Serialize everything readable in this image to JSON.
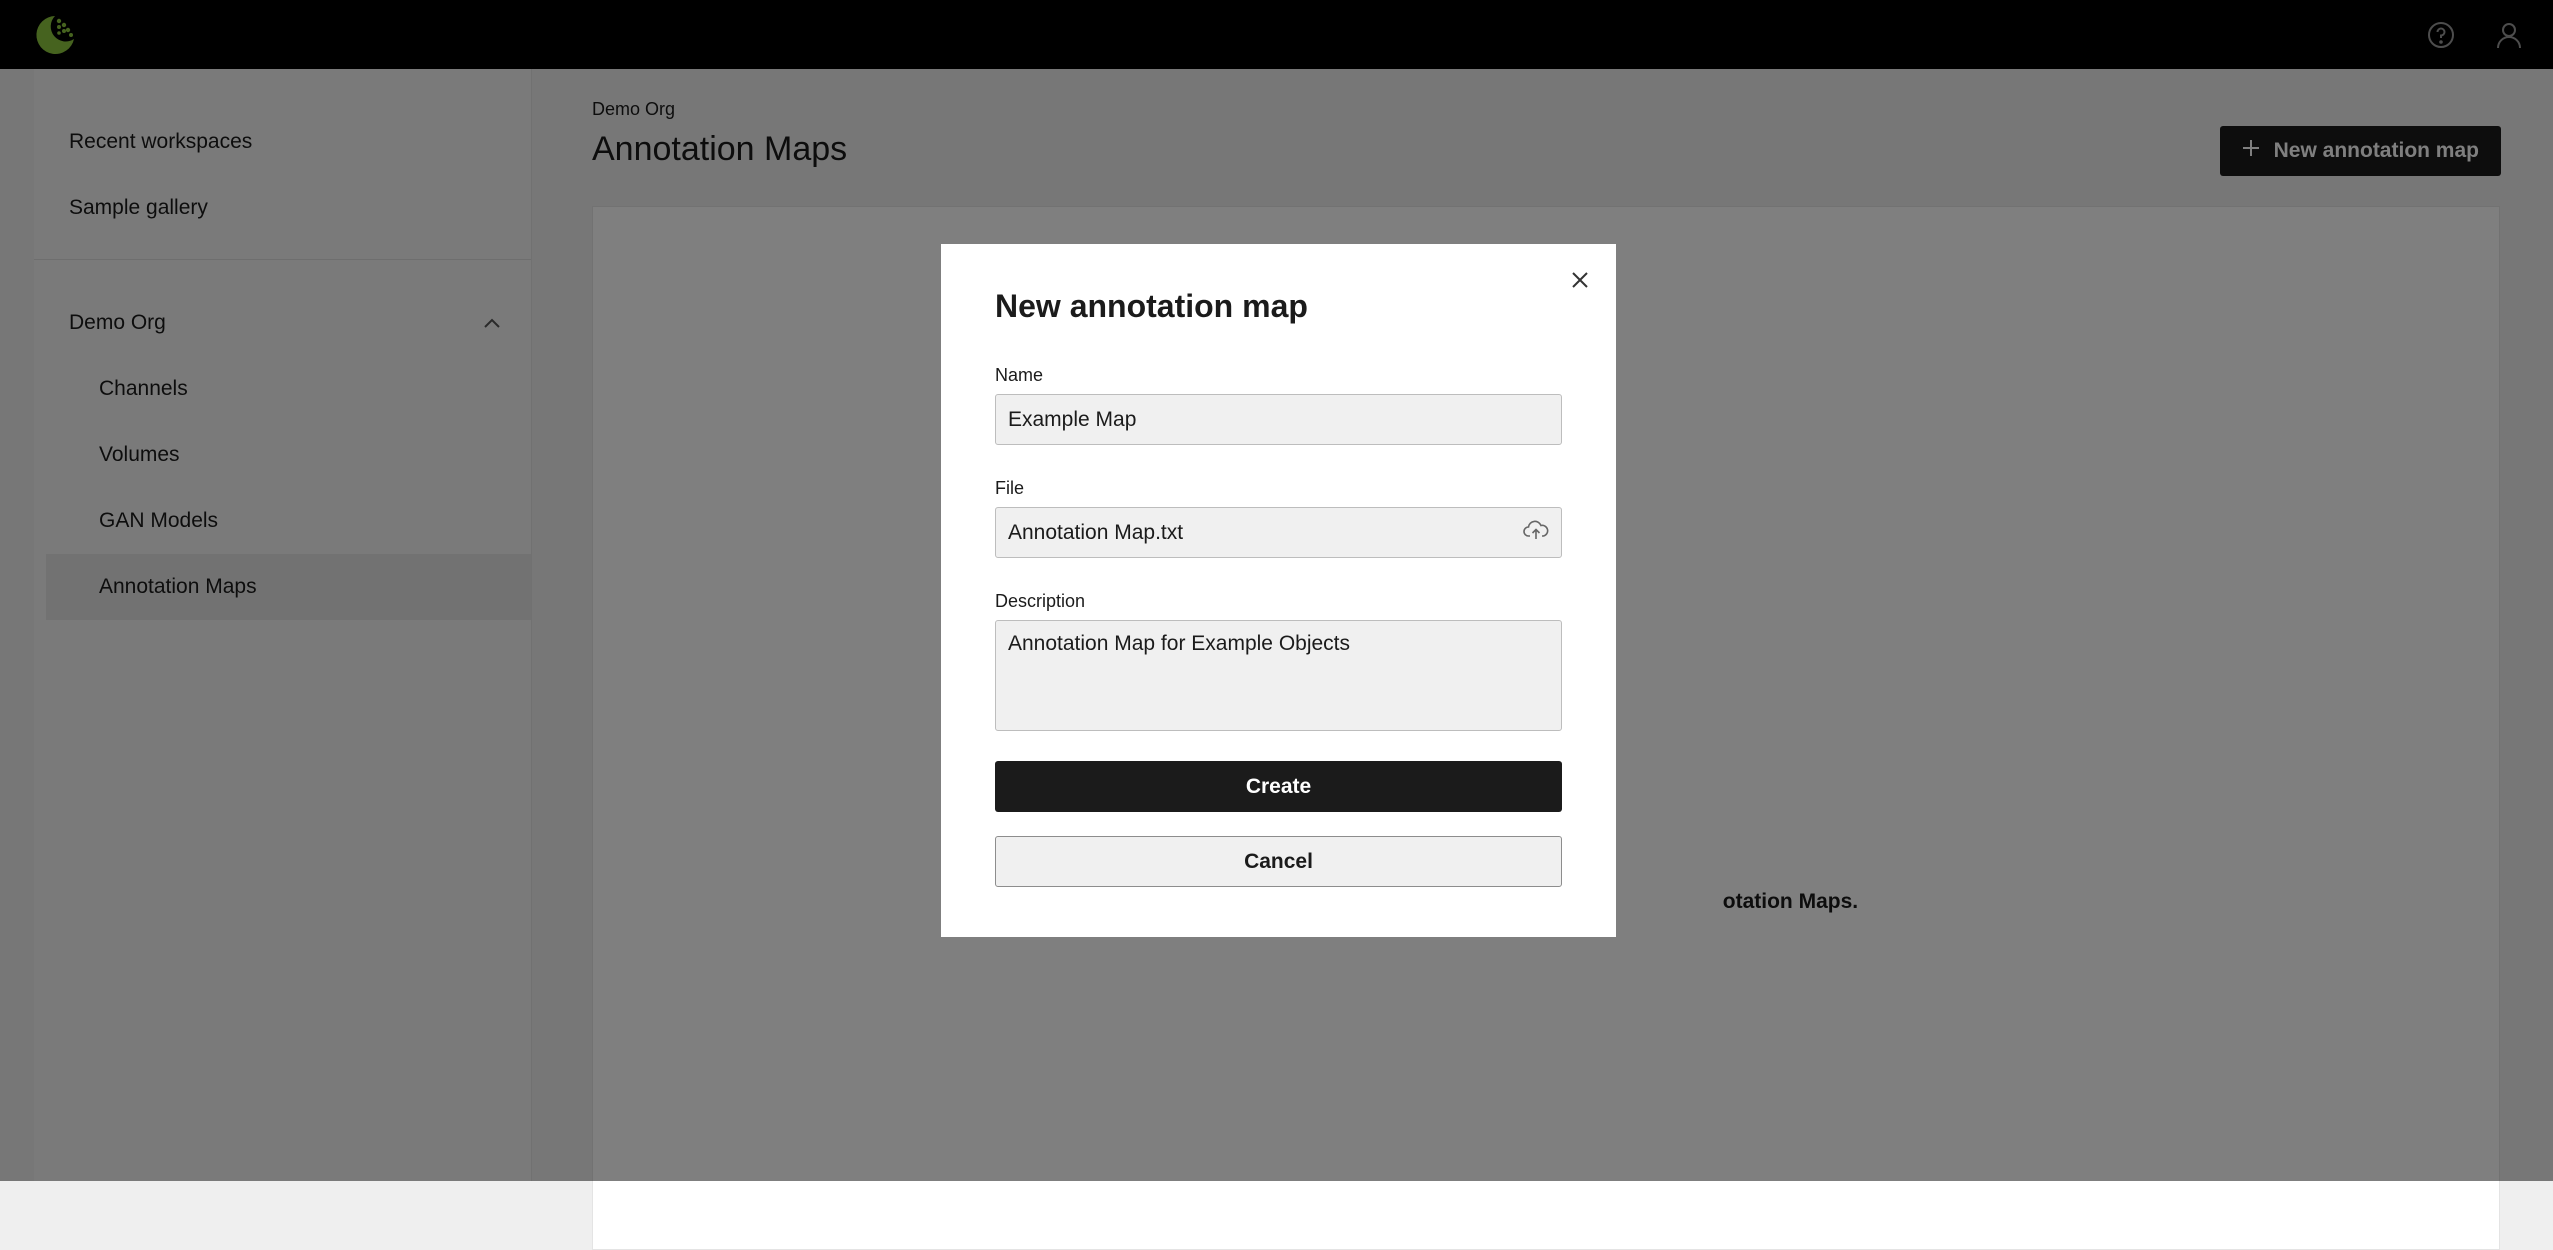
{
  "topbar": {
    "logo_icon": "brand-logo-icon",
    "help_icon": "help-circle-icon",
    "user_icon": "user-icon"
  },
  "sidebar": {
    "top_items": [
      {
        "label": "Recent workspaces"
      },
      {
        "label": "Sample gallery"
      }
    ],
    "org": {
      "label": "Demo Org",
      "expanded": true,
      "items": [
        {
          "label": "Channels"
        },
        {
          "label": "Volumes"
        },
        {
          "label": "GAN Models"
        },
        {
          "label": "Annotation Maps",
          "active": true
        }
      ]
    }
  },
  "main": {
    "breadcrumb": "Demo Org",
    "title": "Annotation Maps",
    "new_button_label": "New annotation map",
    "empty_text_visible": "otation Maps."
  },
  "modal": {
    "title": "New annotation map",
    "name_label": "Name",
    "name_value": "Example Map",
    "file_label": "File",
    "file_value": "Annotation Map.txt",
    "description_label": "Description",
    "description_value": "Annotation Map for Example Objects",
    "create_label": "Create",
    "cancel_label": "Cancel"
  },
  "colors": {
    "topbar": "#000000",
    "brand_green": "#8dc63f",
    "primary_button": "#1b1b1b"
  }
}
